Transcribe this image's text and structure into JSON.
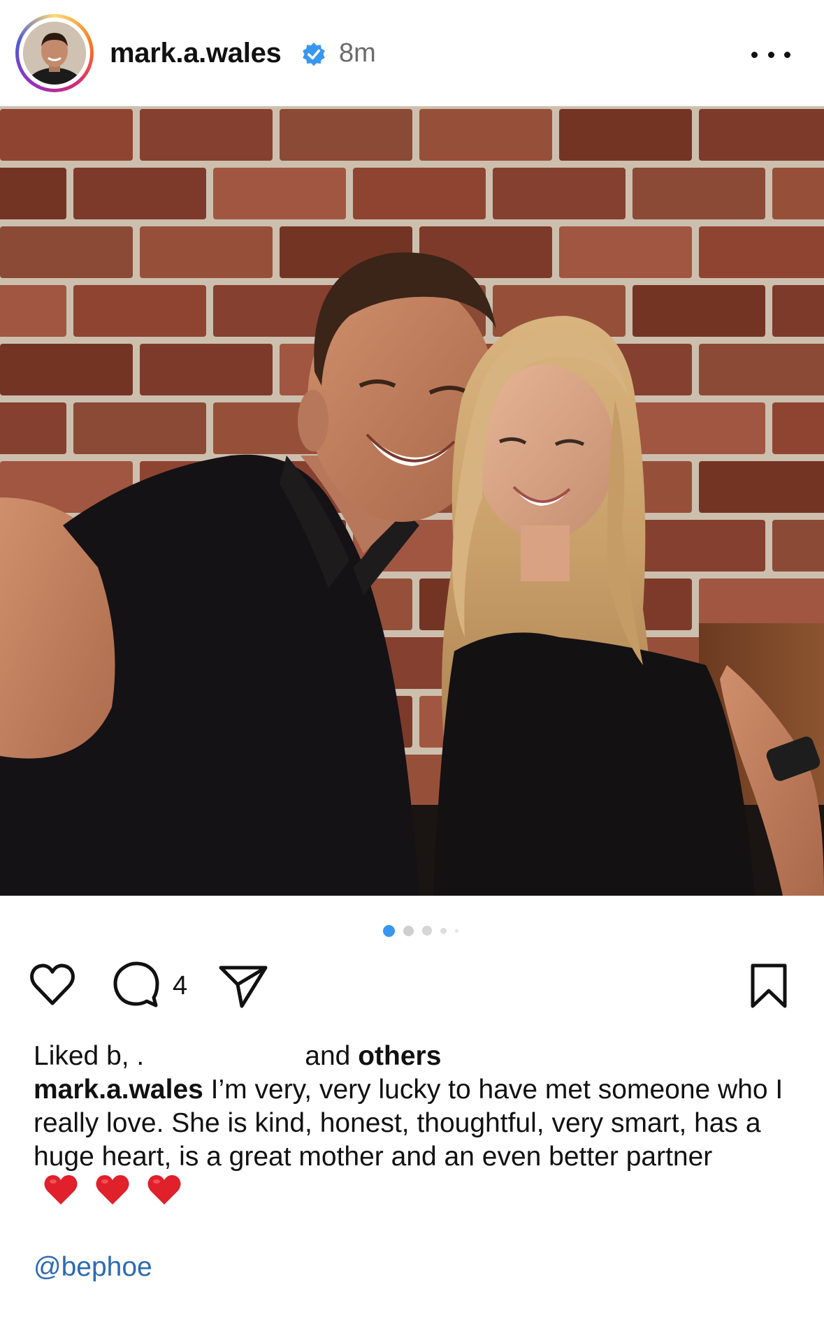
{
  "post": {
    "username": "mark.a.wales",
    "verified": true,
    "time": "8m",
    "more_icon": "more-horizontal-icon"
  },
  "carousel": {
    "total": 5,
    "active": 1
  },
  "actions": {
    "like_icon": "heart-outline-icon",
    "comment_icon": "comment-bubble-icon",
    "comment_count": "4",
    "share_icon": "paper-plane-icon",
    "save_icon": "bookmark-icon"
  },
  "likes": {
    "prefix": "Liked b",
    "partial": ", .",
    "suffix_and": "and ",
    "others": "others"
  },
  "caption": {
    "username": "mark.a.wales",
    "text": " I’m very, very lucky to have met someone who I really love. She is kind, honest, thoughtful, very smart, has a huge heart, is a great mother and an even better partner",
    "emoji": [
      "red-heart",
      "red-heart",
      "red-heart"
    ]
  },
  "mention": "@bephoe",
  "colors": {
    "accent_blue": "#3897f0",
    "mention_blue": "#2d6ab3",
    "verified_blue": "#3897f0",
    "heart_red": "#e0202a",
    "text": "#111111",
    "muted": "#6b6b6b"
  }
}
